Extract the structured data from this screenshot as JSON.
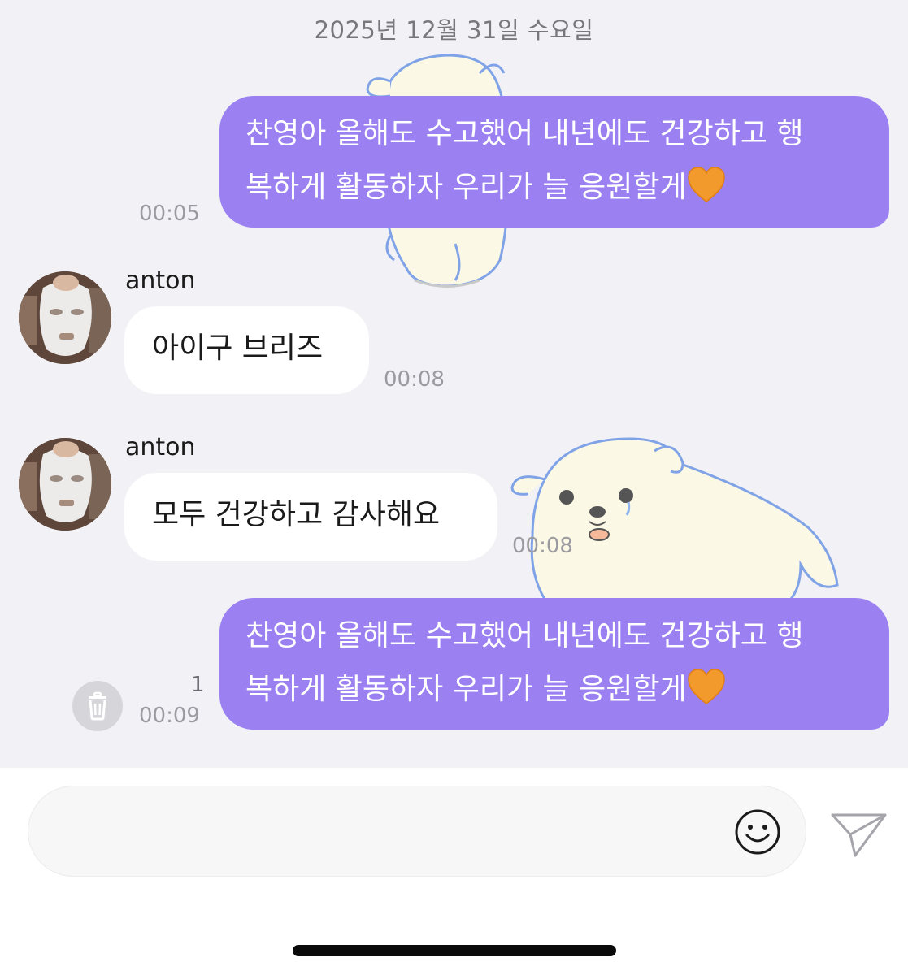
{
  "chat": {
    "date_header": "2025년 12월 31일 수요일",
    "messages": [
      {
        "direction": "outgoing",
        "line1": "찬영아 올해도 수고했어 내년에도 건강하고 행",
        "line2": "복하게 활동하자 우리가 늘 응원할게",
        "emoji": "orange-heart",
        "time": "00:05"
      },
      {
        "direction": "incoming",
        "sender": "anton",
        "text": "아이구 브리즈",
        "time": "00:08"
      },
      {
        "direction": "incoming",
        "sender": "anton",
        "text": "모두 건강하고 감사해요",
        "time": "00:08"
      },
      {
        "direction": "outgoing",
        "line1": "찬영아 올해도 수고했어 내년에도 건강하고 행",
        "line2": "복하게 활동하자 우리가 늘 응원할게",
        "emoji": "orange-heart",
        "time": "00:09",
        "unread_count": "1"
      }
    ]
  },
  "composer": {
    "placeholder": "",
    "emoji_icon": "smiley-icon",
    "send_icon": "paper-plane-icon"
  },
  "colors": {
    "outgoing_bubble": "#9b80f1",
    "incoming_bubble": "#ffffff",
    "chat_background": "#f2f2f6",
    "heart": "#f39a2c"
  }
}
